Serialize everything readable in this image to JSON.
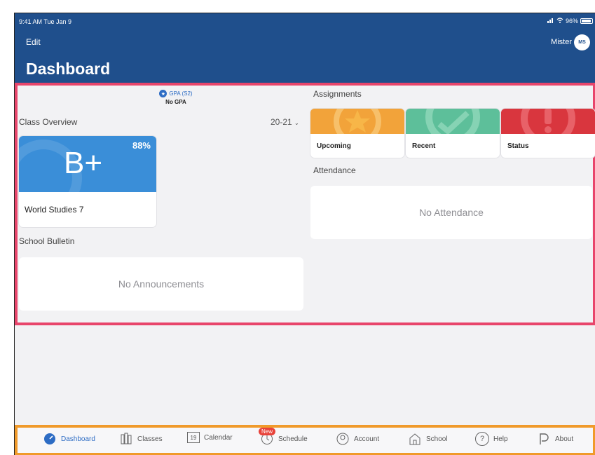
{
  "status_bar": {
    "time": "9:41 AM  Tue Jan 9",
    "battery": "96%"
  },
  "header": {
    "edit_label": "Edit",
    "user_name": "Mister",
    "avatar_initials": "MS",
    "title": "Dashboard"
  },
  "gpa": {
    "label": "GPA (S2)",
    "value": "No GPA"
  },
  "class_overview": {
    "heading": "Class Overview",
    "year": "20-21",
    "cards": [
      {
        "grade": "B+",
        "percent": "88%",
        "name": "World Studies 7"
      }
    ]
  },
  "school_bulletin": {
    "heading": "School Bulletin",
    "empty_text": "No Announcements"
  },
  "assignments": {
    "heading": "Assignments",
    "tiles": [
      {
        "label": "Upcoming",
        "color": "#f2a33a"
      },
      {
        "label": "Recent",
        "color": "#5dbf9a"
      },
      {
        "label": "Status",
        "color": "#d9363e"
      }
    ]
  },
  "attendance": {
    "heading": "Attendance",
    "empty_text": "No Attendance"
  },
  "tabbar": {
    "items": [
      {
        "label": "Dashboard",
        "icon": "dashboard-icon"
      },
      {
        "label": "Classes",
        "icon": "classes-icon"
      },
      {
        "label": "Calendar",
        "icon": "calendar-icon",
        "icon_text": "19"
      },
      {
        "label": "Schedule",
        "icon": "schedule-icon",
        "badge": "New"
      },
      {
        "label": "Account",
        "icon": "account-icon"
      },
      {
        "label": "School",
        "icon": "school-icon"
      },
      {
        "label": "Help",
        "icon": "help-icon",
        "icon_text": "?"
      },
      {
        "label": "About",
        "icon": "about-icon"
      }
    ]
  },
  "colors": {
    "header": "#1f4f8c",
    "accent": "#2d6cc4",
    "highlight_outline": "#e8456b",
    "tabbar_outline": "#f09a2a"
  }
}
